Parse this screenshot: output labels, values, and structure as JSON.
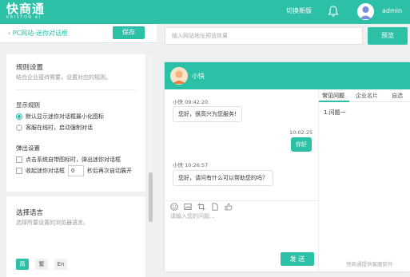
{
  "topbar": {
    "logo": "快商通",
    "logo_sub": "KRISTON AI",
    "switch_version": "切换新版",
    "username": "admin"
  },
  "left": {
    "back_label": "PC网站-迷你对话框",
    "save_label": "保存",
    "rules": {
      "title": "规则设置",
      "desc": "结合企业接待需要，设置对应的规则。",
      "display_rules_title": "显示规则",
      "option_minimize": "默认显示迷你对话框最小化图标",
      "option_force": "客服在线时，启动强制对话",
      "popup_title": "弹出设置",
      "popup_on_message": "点击系统自带图标时，弹出迷你对话框",
      "collapse_prefix": "收起迷你对话框",
      "collapse_value": "0",
      "collapse_suffix": "秒后再次自动展开"
    },
    "language": {
      "title": "选择语言",
      "desc": "选择所要设置的浏览器语言。",
      "options": [
        "简",
        "繁",
        "En"
      ]
    }
  },
  "preview": {
    "url_placeholder": "输入网站地址预览效果",
    "preview_label": "预览"
  },
  "chat": {
    "agent_name": "小快",
    "messages": [
      {
        "meta": "小快 09:42:20",
        "text": "您好，很高兴为您服务!"
      },
      {
        "meta": "10:02:25",
        "text": "你好"
      },
      {
        "meta": "小快 10:26:57",
        "text": "您好，请问有什么可以帮助您的吗？"
      }
    ],
    "input_placeholder": "请输入您的问题...",
    "send_label": "发 送",
    "tabs": [
      "常见问题",
      "企业名片",
      "自选"
    ],
    "faq": [
      "1.问题一"
    ],
    "powered_by": "快商通提供客服软件"
  },
  "colors": {
    "accent": "#2cc0a7"
  }
}
